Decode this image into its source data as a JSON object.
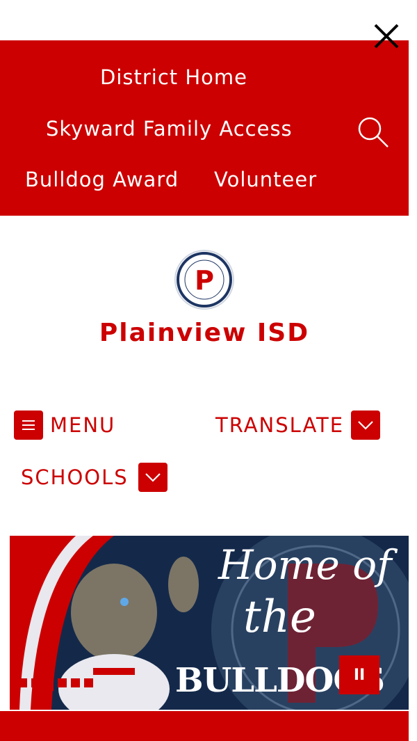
{
  "utility_nav": {
    "links": [
      "District Home",
      "Skyward Family Access",
      "Bulldog Award",
      "Volunteer"
    ]
  },
  "brand": {
    "logo_letter": "P",
    "title": "Plainview ISD"
  },
  "main_nav": {
    "menu_label": "MENU",
    "translate_label": "TRANSLATE",
    "schools_label": "SCHOOLS"
  },
  "banner": {
    "line1": "Home of",
    "line2": "the",
    "line3": "BULLDOGS",
    "pause_symbol": "II",
    "slide_count": 6
  },
  "colors": {
    "brand_red": "#cc0000",
    "navy": "#14294a"
  },
  "icons": [
    "close-icon",
    "search-icon",
    "hamburger-icon",
    "chevron-down-icon",
    "pause-icon"
  ]
}
